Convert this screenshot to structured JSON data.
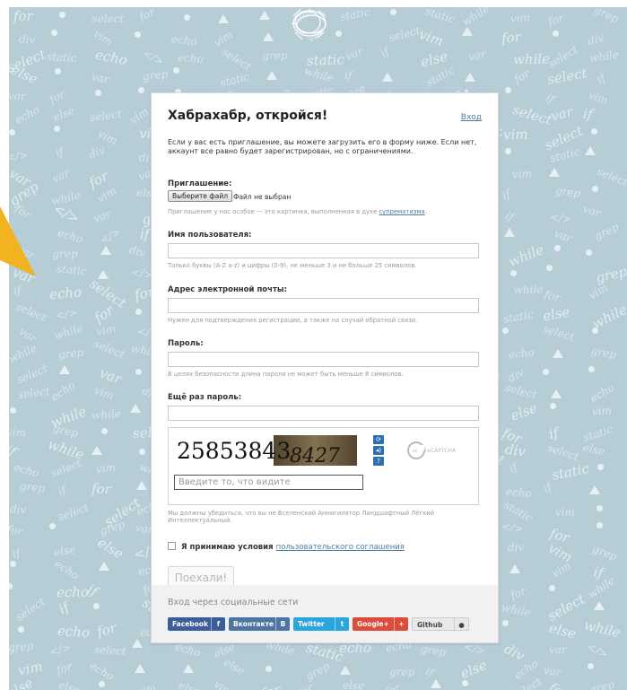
{
  "background": {
    "words": [
      "select",
      "while",
      "var",
      "vim",
      "static",
      "for",
      "if",
      "div",
      "else",
      "grep",
      "echo",
      "</>"
    ]
  },
  "form": {
    "title": "Хабрахабр, откройся!",
    "login_link": "Вход",
    "intro": "Если у вас есть приглашение, вы можете загрузить его в форму ниже. Если нет, аккаунт все равно будет зарегистрирован, но с ограничениями.",
    "invite": {
      "label": "Приглашение:",
      "button": "Выберите файл",
      "status": "Файл не выбран",
      "hint": "Приглашение у нас особое — это картинка, выполненная в духе",
      "hint_link": "супрематизма"
    },
    "username": {
      "label": "Имя пользователя:",
      "value": "",
      "hint": "Только буквы (A-Z a-z) и цифры (0-9), не меньше 3 и не больше 25 символов."
    },
    "email": {
      "label": "Адрес электронной почты:",
      "value": "",
      "hint": "Нужен для подтверждения регистрации, а также на случай обратной связи."
    },
    "password": {
      "label": "Пароль:",
      "value": "",
      "hint": "В целях безопасности длина пароля не может быть меньше 8 символов."
    },
    "password_repeat": {
      "label": "Ещё раз пароль:",
      "value": ""
    },
    "captcha": {
      "word1": "25853843",
      "word2": "8427",
      "placeholder": "Введите то, что видите",
      "brand": "reCAPTCHA",
      "note": "Мы должны убедиться, что вы не Вселенский Аннигилятор Ландшафтный Лёгкий Интеллектуальный."
    },
    "terms": {
      "text": "Я принимаю условия",
      "link": "пользовательского соглашения"
    },
    "submit_label": "Поехали!"
  },
  "social": {
    "title": "Вход через социальные сети",
    "buttons": [
      {
        "label": "Facebook",
        "icon": "f",
        "color": "#3b5e99"
      },
      {
        "label": "Вконтакте",
        "icon": "B",
        "color": "#4c75a3"
      },
      {
        "label": "Twitter",
        "icon": "t",
        "color": "#2aa6dc"
      },
      {
        "label": "Google+",
        "icon": "+",
        "color": "#dd4b39"
      },
      {
        "label": "Github",
        "icon": "●",
        "color": "#e9e9e9"
      }
    ]
  }
}
